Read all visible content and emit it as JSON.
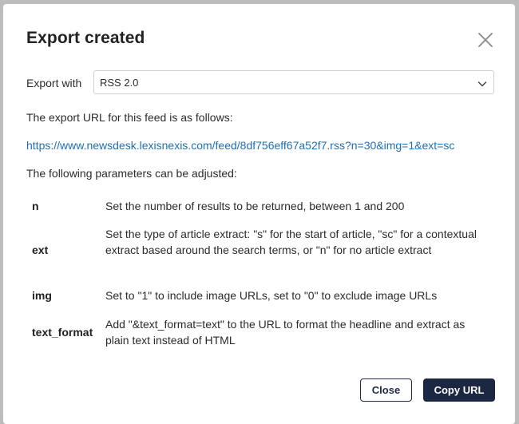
{
  "dialog": {
    "title": "Export created",
    "close_icon": "close-icon"
  },
  "export": {
    "label": "Export with",
    "selected_format": "RSS 2.0",
    "chevron_icon": "chevron-down-icon"
  },
  "url_section": {
    "intro": "The export URL for this feed is as follows:",
    "url": "https://www.newsdesk.lexisnexis.com/feed/8df756eff67a52f7.rss?n=30&img=1&ext=sc"
  },
  "params_section": {
    "intro": "The following parameters can be adjusted:",
    "params": [
      {
        "name": "n",
        "description": "Set the number of results to be returned, between 1 and 200"
      },
      {
        "name": "ext",
        "description": "Set the type of article extract: \"s\" for the start of article, \"sc\" for a contextual extract based around the search terms, or \"n\" for no article extract"
      },
      {
        "name": "img",
        "description": "Set to \"1\" to include image URLs, set to \"0\" to exclude image URLs"
      },
      {
        "name": "text_format",
        "description": "Add \"&text_format=text\" to the URL to format the headline and extract as plain text instead of HTML"
      }
    ]
  },
  "buttons": {
    "close_label": "Close",
    "copy_label": "Copy URL"
  },
  "colors": {
    "link": "#1f6fb2",
    "primary_button": "#1c2842",
    "backdrop": "#bdbdbd"
  }
}
